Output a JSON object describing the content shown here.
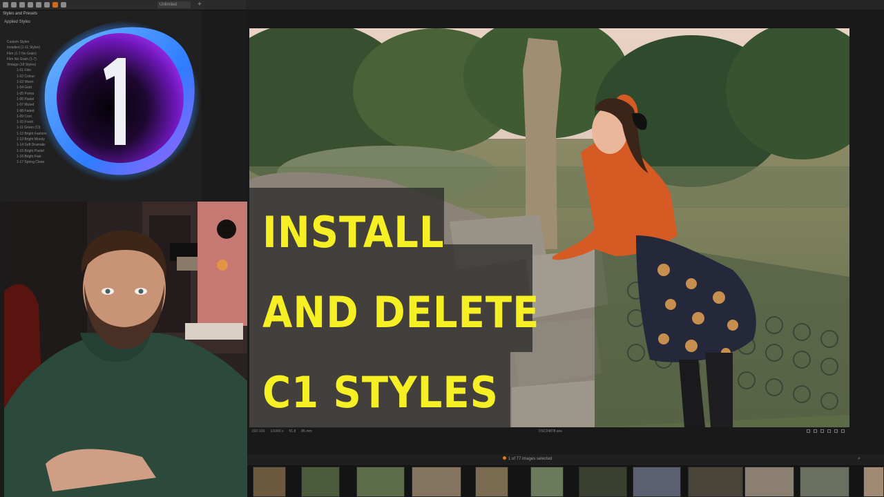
{
  "toolbar": {
    "field_value": "Unlimited",
    "plus_glyph": "+"
  },
  "panel": {
    "title": "Styles and Presets",
    "header_tools": "",
    "applied_row": "Applied Styles",
    "list": [
      "Custom Styles",
      "Installed (1-11 Styles)",
      "Film (1-7 No Grain)",
      "Film No Grain (1-7)",
      "Vintage (18 Styles)",
      "1-01 Film",
      "1-02 Colour",
      "1-03 Warm",
      "1-04 Gold",
      "1-05 Portra",
      "1-06 Pastel",
      "1-07 Muted",
      "1-08 Faded",
      "1-09 Cool",
      "1-10 Fresh",
      "1-11 Green (Cl)",
      "1-12 Bright Fashion",
      "1-13 Bright Moody",
      "1-14 Soft Dramatic",
      "1-15 Bright Pastel",
      "1-16 Bright Fast",
      "1-17 Spring Clean"
    ]
  },
  "photo": {
    "meta": [
      "ISO 100",
      "1/1000 s",
      "f/1.8",
      "85 mm"
    ],
    "file": "DSC04878.arw"
  },
  "title": {
    "line1": "INSTALL",
    "line2": "AND DELETE",
    "line3": "C1 STYLES"
  },
  "filmstrip": {
    "count": "1 of 77 images selected",
    "search_glyph": "⌕"
  },
  "colors": {
    "accent": "#d26a1c",
    "title_yellow": "#f5ef23",
    "logo_glow": "#2f8cff",
    "logo_core": "#8a1fd6"
  }
}
